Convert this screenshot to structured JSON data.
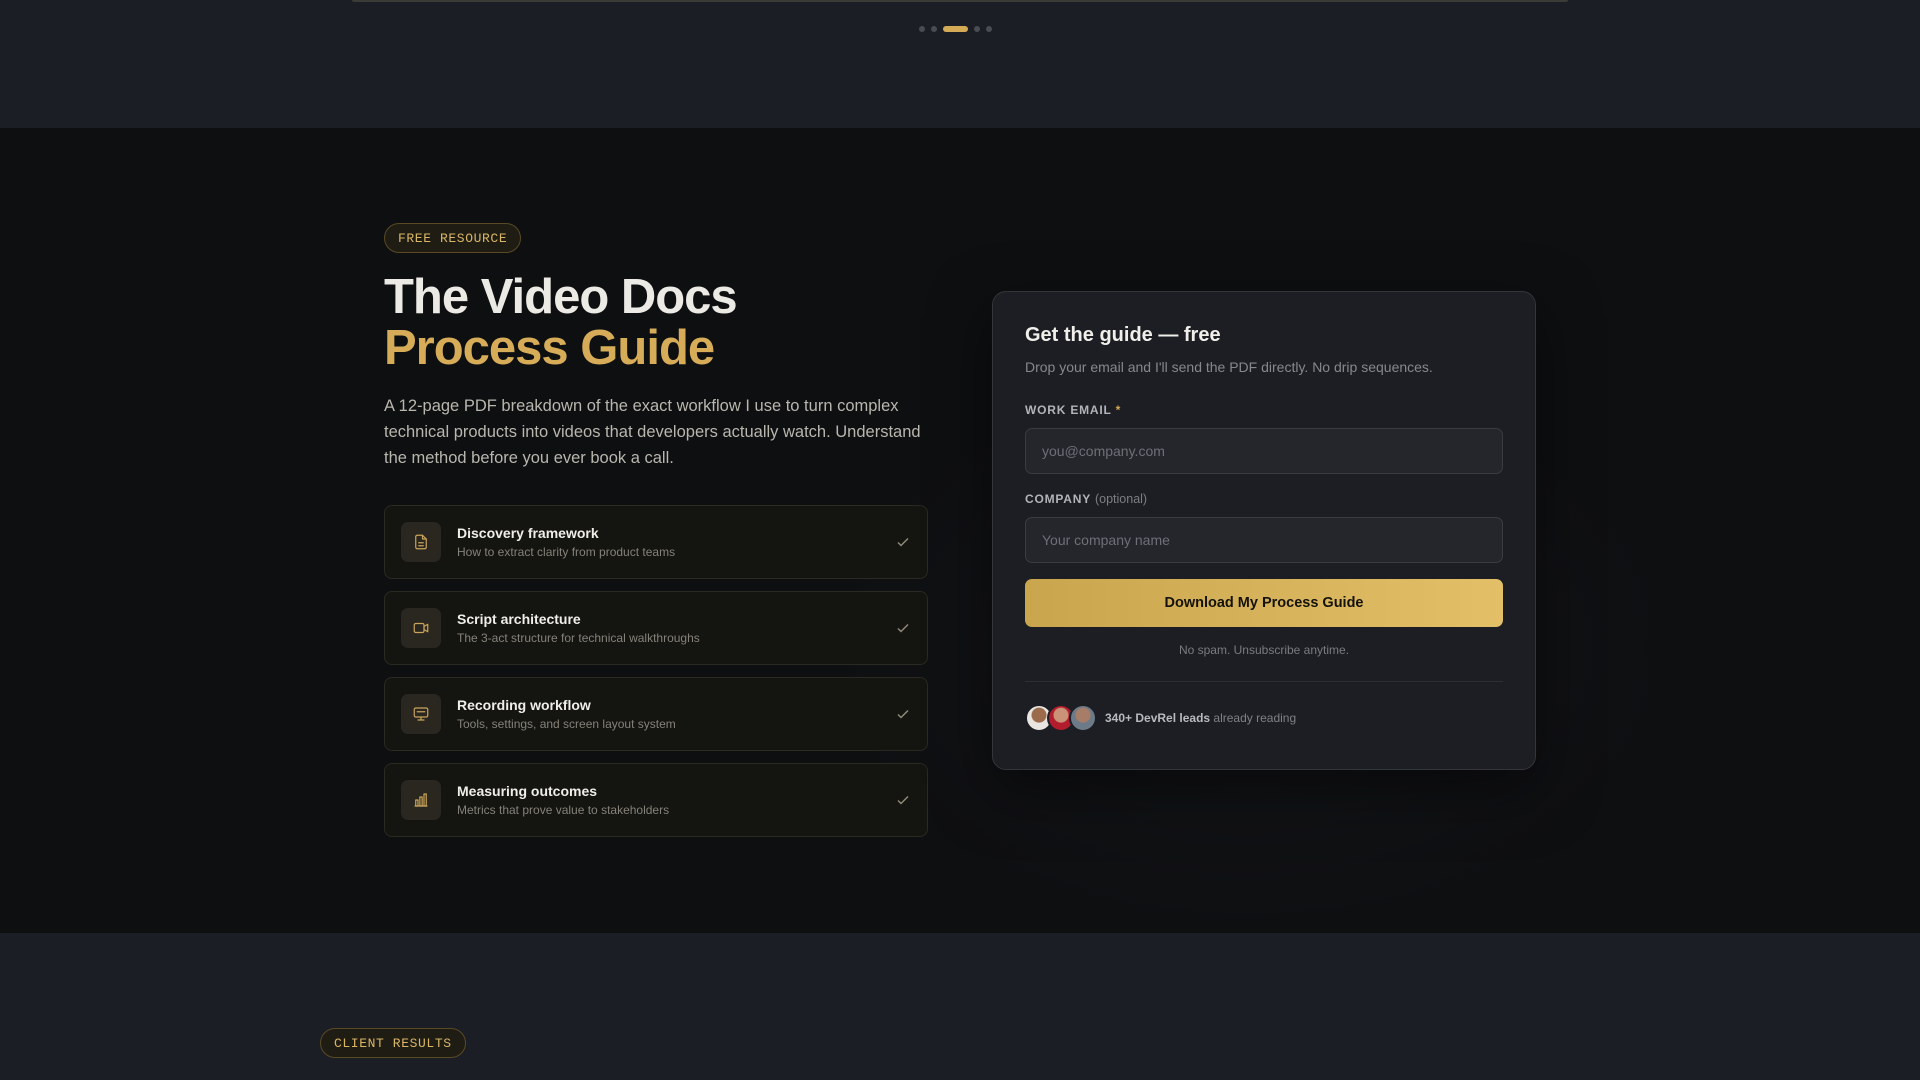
{
  "carousel": {
    "dot_count": 5,
    "active_index": 2
  },
  "hero": {
    "badge": "FREE RESOURCE",
    "title_line1": "The Video Docs",
    "title_line2": "Process Guide",
    "description": "A 12-page PDF breakdown of the exact workflow I use to turn complex technical products into videos that developers actually watch. Understand the method before you ever book a call."
  },
  "features": [
    {
      "icon": "document-icon",
      "title": "Discovery framework",
      "subtitle": "How to extract clarity from product teams"
    },
    {
      "icon": "video-icon",
      "title": "Script architecture",
      "subtitle": "The 3-act structure for technical walkthroughs"
    },
    {
      "icon": "monitor-icon",
      "title": "Recording workflow",
      "subtitle": "Tools, settings, and screen layout system"
    },
    {
      "icon": "bar-chart-icon",
      "title": "Measuring outcomes",
      "subtitle": "Metrics that prove value to stakeholders"
    }
  ],
  "form": {
    "title": "Get the guide — free",
    "subtitle": "Drop your email and I'll send the PDF directly. No drip sequences.",
    "email_label": "WORK EMAIL",
    "email_required_mark": "*",
    "email_placeholder": "you@company.com",
    "company_label": "COMPANY",
    "company_optional": "(optional)",
    "company_placeholder": "Your company name",
    "submit_label": "Download My Process Guide",
    "fine_print": "No spam. Unsubscribe anytime.",
    "social_count": "340+ DevRel leads",
    "social_suffix": "already reading"
  },
  "next_section": {
    "badge": "CLIENT RESULTS"
  },
  "colors": {
    "accent": "#d4aa55",
    "background": "#0e0f11",
    "card": "#1c1e23"
  }
}
